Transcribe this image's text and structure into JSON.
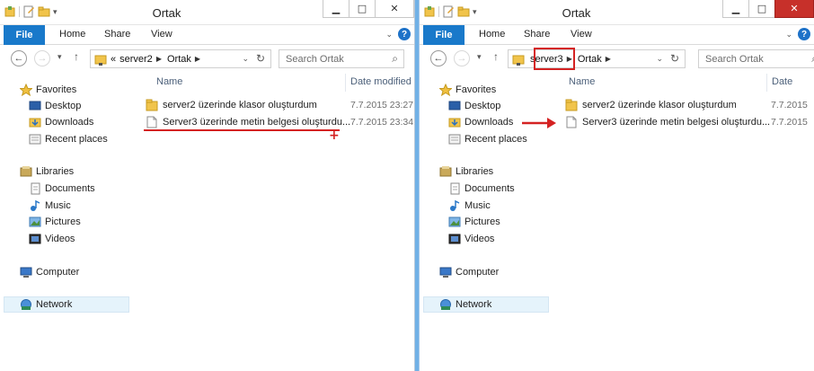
{
  "left_window": {
    "title": "Ortak",
    "ribbon": {
      "file": "File",
      "home": "Home",
      "share": "Share",
      "view": "View",
      "help": "?"
    },
    "address": {
      "prefix": "«",
      "crumbs": [
        "server2",
        "Ortak"
      ]
    },
    "search": {
      "placeholder": "Search Ortak"
    },
    "nav": {
      "favorites": "Favorites",
      "desktop": "Desktop",
      "downloads": "Downloads",
      "recent": "Recent places",
      "libraries": "Libraries",
      "documents": "Documents",
      "music": "Music",
      "pictures": "Pictures",
      "videos": "Videos",
      "computer": "Computer",
      "network": "Network"
    },
    "columns": {
      "name": "Name",
      "date": "Date modified"
    },
    "files": [
      {
        "name": "server2 üzerinde klasor oluşturdum",
        "date": "7.7.2015 23:27",
        "type": "folder"
      },
      {
        "name": "Server3 üzerinde metin belgesi oluşturdu...",
        "date": "7.7.2015 23:34",
        "type": "document"
      }
    ],
    "annotation": "+"
  },
  "right_window": {
    "title": "Ortak",
    "ribbon": {
      "file": "File",
      "home": "Home",
      "share": "Share",
      "view": "View",
      "help": "?"
    },
    "address": {
      "crumbs": [
        "server3",
        "Ortak"
      ]
    },
    "search": {
      "placeholder": "Search Ortak"
    },
    "nav": {
      "favorites": "Favorites",
      "desktop": "Desktop",
      "downloads": "Downloads",
      "recent": "Recent places",
      "libraries": "Libraries",
      "documents": "Documents",
      "music": "Music",
      "pictures": "Pictures",
      "videos": "Videos",
      "computer": "Computer",
      "network": "Network"
    },
    "columns": {
      "name": "Name",
      "date": "Date"
    },
    "files": [
      {
        "name": "server2 üzerinde klasor oluşturdum",
        "date": "7.7.2015",
        "type": "folder"
      },
      {
        "name": "Server3 üzerinde metin belgesi oluşturdu...",
        "date": "7.7.2015",
        "type": "document"
      }
    ]
  },
  "colors": {
    "accent": "#1979ca",
    "annotation": "#d42222",
    "divider": "#71b1e6"
  }
}
